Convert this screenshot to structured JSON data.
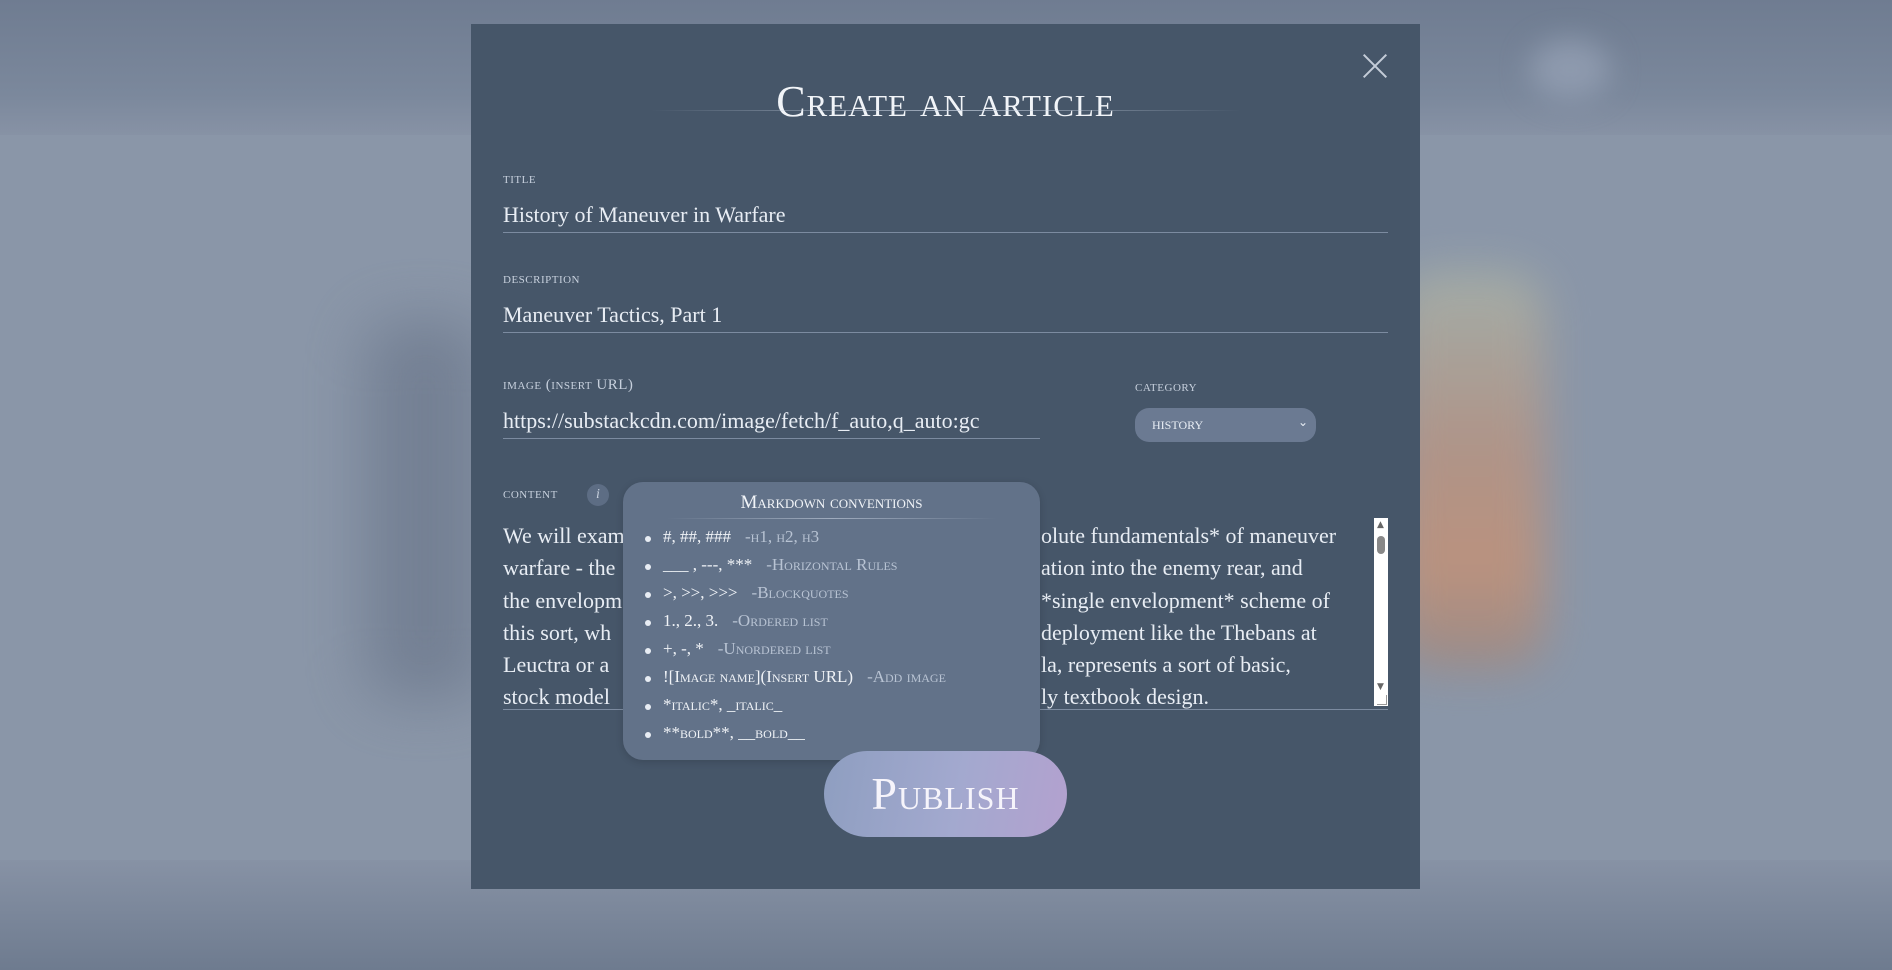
{
  "modal": {
    "title": "Create an article",
    "close_icon": "close-icon"
  },
  "form": {
    "title_label": "title",
    "title_value": "History of Maneuver in Warfare",
    "description_label": "description",
    "description_value": "Maneuver Tactics, Part 1",
    "image_label": "image (insert URL)",
    "image_value": "https://substackcdn.com/image/fetch/f_auto,q_auto:gc",
    "category_label": "category",
    "category_value": "history",
    "content_label": "content",
    "content_info_icon": "i",
    "content_lines": [
      "We will exam",
      "warfare - the",
      "the envelopm",
      "this sort, wh",
      "Leuctra or a",
      "stock model"
    ],
    "content_lines_right": [
      "olute fundamentals* of maneuver",
      "ation into the enemy rear, and",
      "*single envelopment* scheme of",
      "deployment like the Thebans at",
      "la, represents a sort of basic,",
      "ly textbook design."
    ]
  },
  "markdown_tooltip": {
    "title": "Markdown conventions",
    "items": [
      {
        "syntax": "#, ##, ###",
        "desc": "-h1, h2, h3"
      },
      {
        "syntax": "___ , ---, ***",
        "desc": "-Horizontal Rules"
      },
      {
        "syntax": ">, >>, >>>",
        "desc": "-Blockquotes"
      },
      {
        "syntax": "1., 2., 3.",
        "desc": "-Ordered list"
      },
      {
        "syntax": "+, -, *",
        "desc": "-Unordered list"
      },
      {
        "syntax": "![Image name](Insert URL)",
        "desc": "-Add image"
      },
      {
        "syntax": "*italic*, _italic_",
        "desc": ""
      },
      {
        "syntax": "**bold**, __bold__",
        "desc": ""
      }
    ]
  },
  "publish_label": "Publish"
}
